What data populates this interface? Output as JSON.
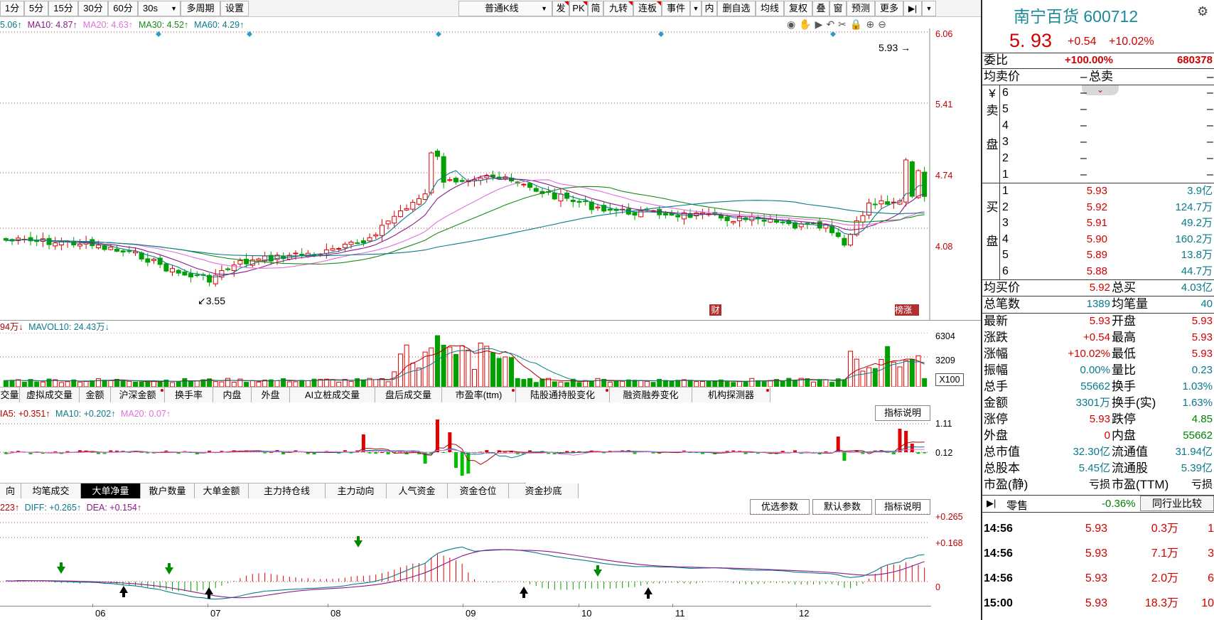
{
  "toolbar": {
    "periods": [
      "1分",
      "5分",
      "15分",
      "30分",
      "60分",
      "30s"
    ],
    "multi_period": "多周期",
    "settings": "设置",
    "kline_type": "普通K线",
    "tools": [
      "发",
      "PK",
      "简",
      "九转",
      "连板",
      "事件",
      "内",
      "删自选",
      "均线",
      "复权",
      "叠",
      "窗",
      "预测",
      "更多"
    ]
  },
  "main_chart": {
    "legend": [
      {
        "text": "5.06↑",
        "color": "#0a7a8a"
      },
      {
        "text": "MA10: 4.87↑",
        "color": "#8b1a8b"
      },
      {
        "text": "MA20: 4.63↑",
        "color": "#e070e0"
      },
      {
        "text": "MA30: 4.52↑",
        "color": "#1a8a1a"
      },
      {
        "text": "MA60: 4.29↑",
        "color": "#0a7a8a"
      }
    ],
    "price_axis": [
      "6.06",
      "5.41",
      "4.74",
      "4.08"
    ],
    "last_price_marker": "5.93",
    "low_marker": "3.55",
    "badge_fin": "财",
    "badge_bang": "榜",
    "badge_zhang": "涨"
  },
  "volume_chart": {
    "legend_1": "94万↓",
    "legend_2": "MAVOL10: 24.43万↓",
    "axis": [
      "6304",
      "3209"
    ],
    "unit": "X100"
  },
  "indicator_tabs_1": {
    "tabs": [
      "交量",
      "虚拟成交量",
      "金额",
      "沪深金额",
      "换手率",
      "内盘",
      "外盘",
      "AI立桩成交量",
      "盘后成交量",
      "市盈率(ttm)",
      "陆股通持股变化",
      "融资融券变化",
      "机构探测器"
    ],
    "dot_tabs": [
      3,
      9,
      10,
      12
    ]
  },
  "big_order_chart": {
    "legend_1": "IA5: +0.351↑",
    "legend_2": "MA10: +0.202↑",
    "legend_3": "MA20: 0.07↑",
    "axis": [
      "1.11",
      "0.12"
    ],
    "help": "指标说明"
  },
  "indicator_tabs_2": {
    "tabs": [
      "向",
      "均笔成交",
      "大单净量",
      "散户数量",
      "大单金额",
      "主力持仓线",
      "主力动向",
      "人气资金",
      "资金仓位",
      "资金抄底"
    ],
    "active": 2
  },
  "macd_chart": {
    "legend_1": "223↑",
    "legend_2": "DIFF: +0.265↑",
    "legend_3": "DEA: +0.154↑",
    "axis": [
      "+0.265",
      "+0.168",
      "0"
    ],
    "btn_preferred": "优选参数",
    "btn_default": "默认参数",
    "btn_help": "指标说明"
  },
  "x_axis": [
    "06",
    "07",
    "08",
    "09",
    "10",
    "11",
    "12"
  ],
  "quote": {
    "name": "南宁百货",
    "code": "600712",
    "price": "5. 93",
    "change": "+0.54",
    "change_pct": "+10.02%",
    "weibi_label": "委比",
    "weibi_pct": "+100.00%",
    "weibi_val": "680378",
    "avg_sell_label": "均卖价",
    "total_sell_label": "总卖",
    "sell_side_label": "卖盘",
    "sell_levels": [
      {
        "n": "6",
        "p": "–",
        "v": "–"
      },
      {
        "n": "5",
        "p": "–",
        "v": "–"
      },
      {
        "n": "4",
        "p": "–",
        "v": "–"
      },
      {
        "n": "3",
        "p": "–",
        "v": "–"
      },
      {
        "n": "2",
        "p": "–",
        "v": "–"
      },
      {
        "n": "1",
        "p": "–",
        "v": "–"
      }
    ],
    "buy_side_label": "买盘",
    "buy_levels": [
      {
        "n": "1",
        "p": "5.93",
        "v": "3.9亿"
      },
      {
        "n": "2",
        "p": "5.92",
        "v": "124.7万"
      },
      {
        "n": "3",
        "p": "5.91",
        "v": "49.2万"
      },
      {
        "n": "4",
        "p": "5.90",
        "v": "160.2万"
      },
      {
        "n": "5",
        "p": "5.89",
        "v": "13.8万"
      },
      {
        "n": "6",
        "p": "5.88",
        "v": "44.7万"
      }
    ],
    "avg_buy_label": "均买价",
    "avg_buy": "5.92",
    "total_buy_label": "总买",
    "total_buy": "4.03亿",
    "total_trades_label": "总笔数",
    "total_trades": "1389",
    "avg_trade_label": "均笔量",
    "avg_trade": "40",
    "stats_left": [
      {
        "l": "最新",
        "v": "5.93",
        "c": "red"
      },
      {
        "l": "涨跌",
        "v": "+0.54",
        "c": "red"
      },
      {
        "l": "涨幅",
        "v": "+10.02%",
        "c": "red"
      },
      {
        "l": "振幅",
        "v": "0.00%",
        "c": "teal"
      },
      {
        "l": "总手",
        "v": "55662",
        "c": "teal"
      },
      {
        "l": "金额",
        "v": "3301万",
        "c": "teal"
      },
      {
        "l": "涨停",
        "v": "5.93",
        "c": "red"
      },
      {
        "l": "外盘",
        "v": "0",
        "c": "red"
      },
      {
        "l": "总市值",
        "v": "32.30亿",
        "c": "teal"
      },
      {
        "l": "总股本",
        "v": "5.45亿",
        "c": "teal"
      },
      {
        "l": "市盈(静)",
        "v": "亏损",
        "c": "black"
      }
    ],
    "stats_right": [
      {
        "l": "开盘",
        "v": "5.93",
        "c": "red"
      },
      {
        "l": "最高",
        "v": "5.93",
        "c": "red"
      },
      {
        "l": "最低",
        "v": "5.93",
        "c": "red"
      },
      {
        "l": "量比",
        "v": "0.23",
        "c": "teal"
      },
      {
        "l": "换手",
        "v": "1.03%",
        "c": "teal"
      },
      {
        "l": "换手(实)",
        "v": "1.63%",
        "c": "teal"
      },
      {
        "l": "跌停",
        "v": "4.85",
        "c": "green"
      },
      {
        "l": "内盘",
        "v": "55662",
        "c": "green"
      },
      {
        "l": "流通值",
        "v": "31.94亿",
        "c": "teal"
      },
      {
        "l": "流通股",
        "v": "5.39亿",
        "c": "teal"
      },
      {
        "l": "市盈(TTM)",
        "v": "亏损",
        "c": "black"
      }
    ],
    "retail_label": "零售",
    "retail_pct": "-0.36%",
    "peer_btn": "同行业比较",
    "ticks": [
      {
        "t": "14:56",
        "p": "5.93",
        "v": "0.3万",
        "n": "1"
      },
      {
        "t": "14:56",
        "p": "5.93",
        "v": "7.1万",
        "n": "3"
      },
      {
        "t": "14:56",
        "p": "5.93",
        "v": "2.0万",
        "n": "6"
      },
      {
        "t": "15:00",
        "p": "5.93",
        "v": "18.3万",
        "n": "10"
      }
    ]
  },
  "colors": {
    "up": "#e00000",
    "down": "#00a000",
    "teal": "#0a7a8a",
    "accent_name": "#1a8a9a"
  }
}
